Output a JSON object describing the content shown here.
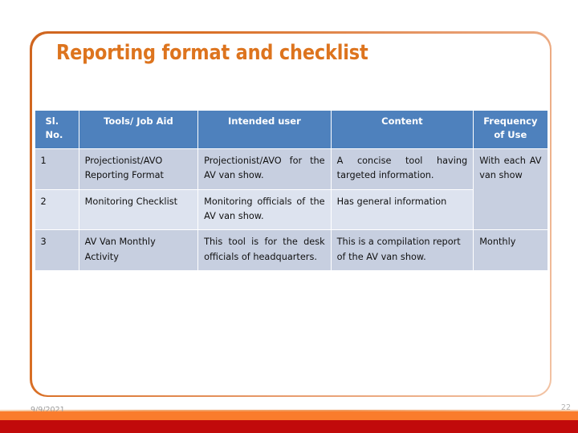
{
  "slide": {
    "title": "Reporting format and checklist",
    "title_color": "#dd741e",
    "frame_color": "#cf651f"
  },
  "table": {
    "header_bg": "#4e81bd",
    "row_bg_dark": "#c7cfe0",
    "row_bg_light": "#dde3ef",
    "headers": {
      "sl_no": "Sl. No.",
      "sl_no_line1": "Sl.",
      "sl_no_line2": "No.",
      "tools": "Tools/ Job Aid",
      "intended_user": "Intended user",
      "content": "Content",
      "frequency_line1": "Frequency",
      "frequency_line2": "of Use"
    },
    "rows": [
      {
        "sl_no": "1",
        "tools": "Projectionist/AVO Reporting Format",
        "intended_user": "Projectionist/AVO for the AV van show.",
        "content": "A concise tool having targeted information.",
        "frequency": "With each AV van show"
      },
      {
        "sl_no": "2",
        "tools": "Monitoring Checklist",
        "intended_user": "Monitoring officials of the AV van show.",
        "content": "Has general information",
        "frequency": ""
      },
      {
        "sl_no": "3",
        "tools": "AV Van Monthly Activity",
        "intended_user": "This tool is for the desk officials of headquarters.",
        "content": "This is a compilation report of the AV van show.",
        "frequency": "Monthly"
      }
    ]
  },
  "footer": {
    "date": "9/9/2021",
    "page_number": "22",
    "bar_orange": "#fa7c2c",
    "bar_red": "#c10a0b"
  }
}
